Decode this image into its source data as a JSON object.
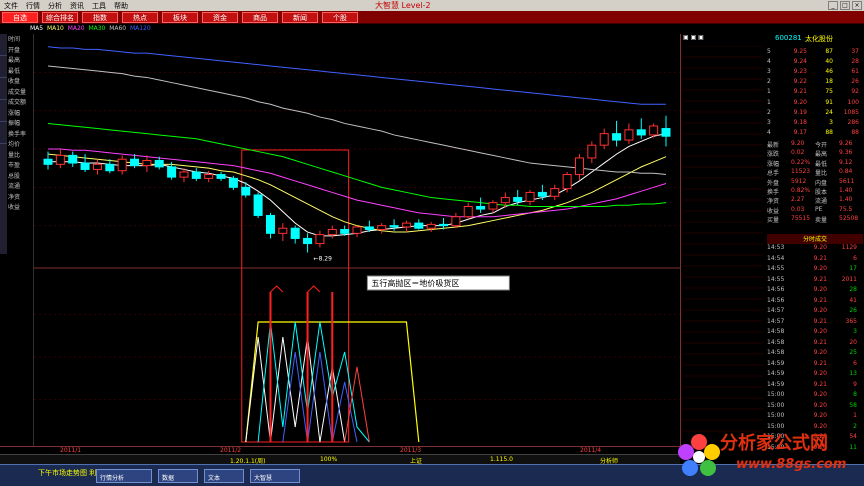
{
  "menu": {
    "items": [
      "文件",
      "行情",
      "分析",
      "资讯",
      "工具",
      "帮助"
    ],
    "title": "大智慧 Level-2"
  },
  "tabs": [
    "自选",
    "综合排名",
    "指数",
    "热点",
    "板块",
    "资金",
    "商品",
    "新闻",
    "个股"
  ],
  "chart_data": {
    "type": "candlestick",
    "candles": [
      {
        "i": 0,
        "o": 9.02,
        "h": 9.08,
        "l": 8.94,
        "c": 8.98,
        "up": false
      },
      {
        "i": 1,
        "o": 8.98,
        "h": 9.1,
        "l": 8.95,
        "c": 9.05,
        "up": true
      },
      {
        "i": 2,
        "o": 9.05,
        "h": 9.08,
        "l": 8.96,
        "c": 8.99,
        "up": false
      },
      {
        "i": 3,
        "o": 8.99,
        "h": 9.06,
        "l": 8.92,
        "c": 8.94,
        "up": false
      },
      {
        "i": 4,
        "o": 8.94,
        "h": 9.02,
        "l": 8.9,
        "c": 8.98,
        "up": true
      },
      {
        "i": 5,
        "o": 8.98,
        "h": 9.02,
        "l": 8.91,
        "c": 8.93,
        "up": false
      },
      {
        "i": 6,
        "o": 8.93,
        "h": 9.05,
        "l": 8.9,
        "c": 9.02,
        "up": true
      },
      {
        "i": 7,
        "o": 9.02,
        "h": 9.06,
        "l": 8.95,
        "c": 8.97,
        "up": false
      },
      {
        "i": 8,
        "o": 8.97,
        "h": 9.05,
        "l": 8.92,
        "c": 9.01,
        "up": true
      },
      {
        "i": 9,
        "o": 9.01,
        "h": 9.04,
        "l": 8.94,
        "c": 8.96,
        "up": false
      },
      {
        "i": 10,
        "o": 8.96,
        "h": 9.0,
        "l": 8.86,
        "c": 8.88,
        "up": false
      },
      {
        "i": 11,
        "o": 8.88,
        "h": 8.95,
        "l": 8.84,
        "c": 8.92,
        "up": true
      },
      {
        "i": 12,
        "o": 8.92,
        "h": 8.95,
        "l": 8.85,
        "c": 8.87,
        "up": false
      },
      {
        "i": 13,
        "o": 8.87,
        "h": 8.93,
        "l": 8.84,
        "c": 8.9,
        "up": true
      },
      {
        "i": 14,
        "o": 8.9,
        "h": 8.92,
        "l": 8.85,
        "c": 8.87,
        "up": false
      },
      {
        "i": 15,
        "o": 8.87,
        "h": 8.89,
        "l": 8.78,
        "c": 8.8,
        "up": false
      },
      {
        "i": 16,
        "o": 8.8,
        "h": 8.84,
        "l": 8.72,
        "c": 8.74,
        "up": false
      },
      {
        "i": 17,
        "o": 8.74,
        "h": 8.76,
        "l": 8.56,
        "c": 8.58,
        "up": false
      },
      {
        "i": 18,
        "o": 8.58,
        "h": 8.6,
        "l": 8.4,
        "c": 8.44,
        "up": false
      },
      {
        "i": 19,
        "o": 8.44,
        "h": 8.52,
        "l": 8.38,
        "c": 8.48,
        "up": true
      },
      {
        "i": 20,
        "o": 8.48,
        "h": 8.5,
        "l": 8.36,
        "c": 8.4,
        "up": false
      },
      {
        "i": 21,
        "o": 8.4,
        "h": 8.44,
        "l": 8.29,
        "c": 8.36,
        "up": false
      },
      {
        "i": 22,
        "o": 8.36,
        "h": 8.46,
        "l": 8.33,
        "c": 8.43,
        "up": true
      },
      {
        "i": 23,
        "o": 8.43,
        "h": 8.5,
        "l": 8.4,
        "c": 8.47,
        "up": true
      },
      {
        "i": 24,
        "o": 8.47,
        "h": 8.5,
        "l": 8.42,
        "c": 8.44,
        "up": false
      },
      {
        "i": 25,
        "o": 8.44,
        "h": 8.5,
        "l": 8.41,
        "c": 8.49,
        "up": true
      },
      {
        "i": 26,
        "o": 8.49,
        "h": 8.54,
        "l": 8.45,
        "c": 8.47,
        "up": false
      },
      {
        "i": 27,
        "o": 8.47,
        "h": 8.52,
        "l": 8.44,
        "c": 8.5,
        "up": true
      },
      {
        "i": 28,
        "o": 8.5,
        "h": 8.55,
        "l": 8.46,
        "c": 8.49,
        "up": false
      },
      {
        "i": 29,
        "o": 8.49,
        "h": 8.54,
        "l": 8.45,
        "c": 8.52,
        "up": true
      },
      {
        "i": 30,
        "o": 8.52,
        "h": 8.55,
        "l": 8.47,
        "c": 8.48,
        "up": false
      },
      {
        "i": 31,
        "o": 8.48,
        "h": 8.53,
        "l": 8.45,
        "c": 8.51,
        "up": true
      },
      {
        "i": 32,
        "o": 8.51,
        "h": 8.56,
        "l": 8.47,
        "c": 8.5,
        "up": false
      },
      {
        "i": 33,
        "o": 8.5,
        "h": 8.6,
        "l": 8.48,
        "c": 8.57,
        "up": true
      },
      {
        "i": 34,
        "o": 8.57,
        "h": 8.68,
        "l": 8.55,
        "c": 8.65,
        "up": true
      },
      {
        "i": 35,
        "o": 8.65,
        "h": 8.72,
        "l": 8.6,
        "c": 8.63,
        "up": false
      },
      {
        "i": 36,
        "o": 8.63,
        "h": 8.7,
        "l": 8.6,
        "c": 8.68,
        "up": true
      },
      {
        "i": 37,
        "o": 8.68,
        "h": 8.76,
        "l": 8.64,
        "c": 8.72,
        "up": true
      },
      {
        "i": 38,
        "o": 8.72,
        "h": 8.78,
        "l": 8.66,
        "c": 8.69,
        "up": false
      },
      {
        "i": 39,
        "o": 8.69,
        "h": 8.78,
        "l": 8.66,
        "c": 8.76,
        "up": true
      },
      {
        "i": 40,
        "o": 8.76,
        "h": 8.82,
        "l": 8.7,
        "c": 8.73,
        "up": false
      },
      {
        "i": 41,
        "o": 8.73,
        "h": 8.82,
        "l": 8.7,
        "c": 8.79,
        "up": true
      },
      {
        "i": 42,
        "o": 8.79,
        "h": 8.92,
        "l": 8.76,
        "c": 8.9,
        "up": true
      },
      {
        "i": 43,
        "o": 8.9,
        "h": 9.06,
        "l": 8.86,
        "c": 9.03,
        "up": true
      },
      {
        "i": 44,
        "o": 9.03,
        "h": 9.16,
        "l": 8.99,
        "c": 9.13,
        "up": true
      },
      {
        "i": 45,
        "o": 9.13,
        "h": 9.26,
        "l": 9.1,
        "c": 9.22,
        "up": true
      },
      {
        "i": 46,
        "o": 9.22,
        "h": 9.32,
        "l": 9.12,
        "c": 9.17,
        "up": false
      },
      {
        "i": 47,
        "o": 9.17,
        "h": 9.3,
        "l": 9.14,
        "c": 9.25,
        "up": true
      },
      {
        "i": 48,
        "o": 9.25,
        "h": 9.34,
        "l": 9.18,
        "c": 9.21,
        "up": false
      },
      {
        "i": 49,
        "o": 9.21,
        "h": 9.3,
        "l": 9.19,
        "c": 9.28,
        "up": true
      },
      {
        "i": 50,
        "o": 9.26,
        "h": 9.36,
        "l": 9.12,
        "c": 9.2,
        "up": false
      }
    ],
    "ma_lines": [
      {
        "name": "MA5",
        "color": "#ffffff",
        "values": [
          9.0,
          9.0,
          9.0,
          8.99,
          8.99,
          8.98,
          8.97,
          8.97,
          8.97,
          8.98,
          8.96,
          8.94,
          8.92,
          8.91,
          8.89,
          8.87,
          8.83,
          8.77,
          8.7,
          8.61,
          8.52,
          8.45,
          8.42,
          8.42,
          8.43,
          8.44,
          8.46,
          8.47,
          8.48,
          8.49,
          8.5,
          8.5,
          8.5,
          8.52,
          8.55,
          8.58,
          8.6,
          8.65,
          8.68,
          8.7,
          8.72,
          8.74,
          8.79,
          8.85,
          8.92,
          8.99,
          9.06,
          9.12,
          9.16,
          9.2,
          9.22
        ]
      },
      {
        "name": "MA10",
        "color": "#ffff66",
        "values": [
          9.06,
          9.05,
          9.04,
          9.03,
          9.02,
          9.01,
          9.0,
          8.99,
          8.98,
          8.98,
          8.98,
          8.97,
          8.96,
          8.95,
          8.93,
          8.92,
          8.89,
          8.86,
          8.82,
          8.77,
          8.72,
          8.67,
          8.62,
          8.57,
          8.53,
          8.5,
          8.48,
          8.46,
          8.45,
          8.45,
          8.46,
          8.47,
          8.48,
          8.49,
          8.5,
          8.52,
          8.54,
          8.56,
          8.58,
          8.6,
          8.62,
          8.65,
          8.68,
          8.72,
          8.76,
          8.81,
          8.86,
          8.91,
          8.96,
          9.0,
          9.04
        ]
      },
      {
        "name": "MA20",
        "color": "#ff40ff",
        "values": [
          9.1,
          9.1,
          9.09,
          9.09,
          9.08,
          9.07,
          9.06,
          9.05,
          9.04,
          9.03,
          9.02,
          9.01,
          9.0,
          8.99,
          8.98,
          8.97,
          8.95,
          8.93,
          8.91,
          8.88,
          8.85,
          8.82,
          8.79,
          8.76,
          8.73,
          8.7,
          8.68,
          8.66,
          8.64,
          8.62,
          8.6,
          8.59,
          8.58,
          8.57,
          8.57,
          8.57,
          8.57,
          8.58,
          8.59,
          8.6,
          8.61,
          8.62,
          8.63,
          8.65,
          8.67,
          8.69,
          8.71,
          8.74,
          8.77,
          8.8,
          8.83
        ]
      },
      {
        "name": "MA30",
        "color": "#00ff00",
        "values": [
          9.3,
          9.29,
          9.28,
          9.27,
          9.26,
          9.25,
          9.24,
          9.23,
          9.22,
          9.21,
          9.2,
          9.19,
          9.18,
          9.16,
          9.14,
          9.12,
          9.1,
          9.08,
          9.06,
          9.04,
          9.01,
          8.98,
          8.95,
          8.92,
          8.89,
          8.86,
          8.83,
          8.8,
          8.78,
          8.76,
          8.74,
          8.72,
          8.71,
          8.7,
          8.69,
          8.68,
          8.67,
          8.66,
          8.66,
          8.65,
          8.65,
          8.65,
          8.65,
          8.65,
          8.65,
          8.65,
          8.66,
          8.66,
          8.67,
          8.67,
          8.68
        ]
      },
      {
        "name": "MA60",
        "color": "#c0c0c0",
        "values": [
          9.75,
          9.74,
          9.73,
          9.72,
          9.71,
          9.7,
          9.69,
          9.67,
          9.66,
          9.64,
          9.62,
          9.6,
          9.58,
          9.56,
          9.54,
          9.52,
          9.5,
          9.47,
          9.45,
          9.42,
          9.4,
          9.38,
          9.35,
          9.33,
          9.3,
          9.28,
          9.26,
          9.24,
          9.21,
          9.19,
          9.17,
          9.15,
          9.13,
          9.11,
          9.09,
          9.07,
          9.05,
          9.03,
          9.01,
          8.99,
          8.98,
          8.97,
          8.96,
          8.95,
          8.94,
          8.93,
          8.92,
          8.92,
          8.91,
          8.91,
          8.9
        ]
      },
      {
        "name": "MA120",
        "color": "#4060ff",
        "values": [
          9.9,
          9.89,
          9.89,
          9.88,
          9.88,
          9.87,
          9.86,
          9.85,
          9.85,
          9.84,
          9.83,
          9.82,
          9.81,
          9.8,
          9.79,
          9.78,
          9.77,
          9.76,
          9.75,
          9.74,
          9.73,
          9.72,
          9.71,
          9.7,
          9.69,
          9.68,
          9.67,
          9.66,
          9.65,
          9.64,
          9.63,
          9.62,
          9.61,
          9.6,
          9.59,
          9.58,
          9.57,
          9.56,
          9.55,
          9.54,
          9.53,
          9.52,
          9.51,
          9.5,
          9.49,
          9.48,
          9.47,
          9.46,
          9.45,
          9.45,
          9.45
        ]
      }
    ],
    "price_range": [
      8.2,
      10.0
    ],
    "low_label": "8.29",
    "highlight_range": [
      16,
      24
    ],
    "annotation": "五行高抛区＝地价吸货区",
    "indicator": {
      "red_bars": [
        {
          "i": 18,
          "v": 1.0
        },
        {
          "i": 21,
          "v": 1.0
        },
        {
          "i": 23,
          "v": 1.0
        }
      ],
      "yellow_plateau": {
        "start": 17,
        "end": 29,
        "level": 0.8
      },
      "zigzag_cyan": [
        [
          17,
          0.0
        ],
        [
          18,
          0.8
        ],
        [
          19,
          0.1
        ],
        [
          20,
          0.8
        ],
        [
          21,
          0.2
        ],
        [
          22,
          0.8
        ],
        [
          23,
          0.3
        ],
        [
          24,
          0.6
        ],
        [
          25,
          0.1
        ],
        [
          26,
          0.0
        ]
      ],
      "zigzag_white": [
        [
          16,
          0.0
        ],
        [
          17,
          0.7
        ],
        [
          18,
          0.0
        ],
        [
          19,
          0.7
        ],
        [
          20,
          0.1
        ],
        [
          21,
          0.7
        ],
        [
          22,
          0.0
        ],
        [
          23,
          0.5
        ],
        [
          24,
          0.0
        ]
      ],
      "zigzag_blue": [
        [
          19,
          0.0
        ],
        [
          20,
          0.6
        ],
        [
          21,
          0.0
        ],
        [
          22,
          0.6
        ],
        [
          23,
          0.0
        ],
        [
          24,
          0.4
        ],
        [
          25,
          0.0
        ]
      ],
      "pink_spike": [
        [
          24,
          0.0
        ],
        [
          25,
          0.5
        ],
        [
          26,
          0.0
        ]
      ]
    }
  },
  "right_panel": {
    "code": "600281",
    "name": "太化股份",
    "orderbook": [
      {
        "lbl": "5",
        "px": "9.25",
        "vol": "87",
        "chg": "37"
      },
      {
        "lbl": "4",
        "px": "9.24",
        "vol": "40",
        "chg": "28"
      },
      {
        "lbl": "3",
        "px": "9.23",
        "vol": "46",
        "chg": "61"
      },
      {
        "lbl": "2",
        "px": "9.22",
        "vol": "18",
        "chg": "26"
      },
      {
        "lbl": "1",
        "px": "9.21",
        "vol": "75",
        "chg": "92"
      },
      {
        "lbl": "1",
        "px": "9.20",
        "vol": "91",
        "chg": "100"
      },
      {
        "lbl": "2",
        "px": "9.19",
        "vol": "24",
        "chg": "1085"
      },
      {
        "lbl": "3",
        "px": "9.18",
        "vol": "3",
        "chg": "286"
      },
      {
        "lbl": "4",
        "px": "9.17",
        "vol": "88",
        "chg": "88"
      }
    ],
    "quotes": [
      {
        "k": "最新",
        "v": "9.20",
        "k2": "今开",
        "v2": "9.26"
      },
      {
        "k": "涨跌",
        "v": "0.02",
        "k2": "最高",
        "v2": "9.36"
      },
      {
        "k": "涨幅",
        "v": "0.22%",
        "k2": "最低",
        "v2": "9.12"
      },
      {
        "k": "总手",
        "v": "11523",
        "k2": "量比",
        "v2": "0.84"
      },
      {
        "k": "外盘",
        "v": "5912",
        "k2": "内盘",
        "v2": "5611"
      },
      {
        "k": "换手",
        "v": "0.82%",
        "k2": "股本",
        "v2": "1.40"
      },
      {
        "k": "净资",
        "v": "2.27",
        "k2": "流通",
        "v2": "1.40"
      },
      {
        "k": "收益",
        "v": "0.03",
        "k2": "PE",
        "v2": "75.5"
      },
      {
        "k": "买量",
        "v": "75515",
        "k2": "卖量",
        "v2": "52508"
      }
    ],
    "ticks_title": "分时成交",
    "ticks": [
      {
        "t": "14:53",
        "p": "9.20",
        "v": "1129",
        "d": "up"
      },
      {
        "t": "14:54",
        "p": "9.21",
        "v": "6",
        "d": "up"
      },
      {
        "t": "14:55",
        "p": "9.20",
        "v": "17",
        "d": "dn"
      },
      {
        "t": "14:55",
        "p": "9.21",
        "v": "2011",
        "d": "up"
      },
      {
        "t": "14:56",
        "p": "9.20",
        "v": "28",
        "d": "dn"
      },
      {
        "t": "14:56",
        "p": "9.21",
        "v": "41",
        "d": "up"
      },
      {
        "t": "14:57",
        "p": "9.20",
        "v": "26",
        "d": "dn"
      },
      {
        "t": "14:57",
        "p": "9.21",
        "v": "365",
        "d": "up"
      },
      {
        "t": "14:58",
        "p": "9.20",
        "v": "3",
        "d": "dn"
      },
      {
        "t": "14:58",
        "p": "9.21",
        "v": "20",
        "d": "up"
      },
      {
        "t": "14:58",
        "p": "9.20",
        "v": "25",
        "d": "dn"
      },
      {
        "t": "14:59",
        "p": "9.21",
        "v": "6",
        "d": "up"
      },
      {
        "t": "14:59",
        "p": "9.20",
        "v": "13",
        "d": "dn"
      },
      {
        "t": "14:59",
        "p": "9.21",
        "v": "9",
        "d": "up"
      },
      {
        "t": "15:00",
        "p": "9.20",
        "v": "8",
        "d": "dn"
      },
      {
        "t": "15:00",
        "p": "9.20",
        "v": "58",
        "d": "dn"
      },
      {
        "t": "15:00",
        "p": "9.20",
        "v": "1",
        "d": "up"
      },
      {
        "t": "15:00",
        "p": "9.20",
        "v": "2",
        "d": "dn"
      },
      {
        "t": "15:00",
        "p": "9.20",
        "v": "54",
        "d": "up"
      },
      {
        "t": "15:00",
        "p": "9.20",
        "v": "11",
        "d": "dn"
      }
    ]
  },
  "left_labels": [
    "时间",
    "开盘",
    "最高",
    "最低",
    "收盘",
    "成交量",
    "成交额",
    "涨幅",
    "振幅",
    "换手率",
    "均价",
    "量比",
    "市盈",
    "总股",
    "流通",
    "净资",
    "收益"
  ],
  "timebar": [
    "2011/1",
    "2011/2",
    "2011/3",
    "2011/4"
  ],
  "bottom": {
    "items": [
      "1.20.1.1(周)",
      "100%",
      "上证",
      "1.115.0",
      "分析师"
    ]
  },
  "taskbar": {
    "ticker": "下午市场走势图 利好消息",
    "buttons": [
      "行情分析",
      "数据",
      "文本",
      "大智慧"
    ]
  },
  "watermark": {
    "text": "分析家公式网",
    "url": "www.88gs.com"
  }
}
